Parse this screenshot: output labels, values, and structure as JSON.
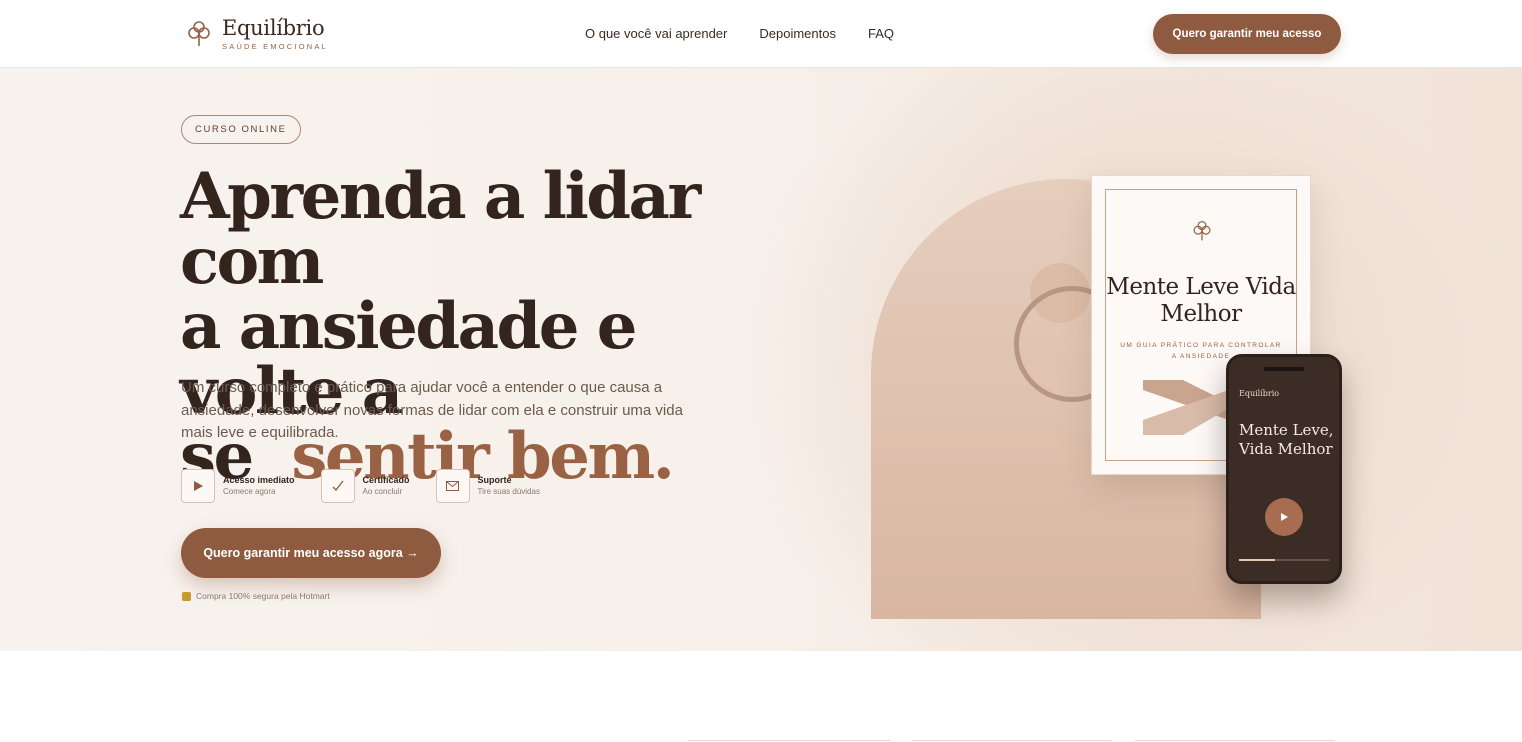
{
  "brand": {
    "name": "Equilíbrio",
    "tagline": "SAÚDE EMOCIONAL"
  },
  "nav": {
    "items": [
      "O que você vai aprender",
      "Depoimentos",
      "FAQ"
    ]
  },
  "header": {
    "cta_label": "Quero garantir meu acesso"
  },
  "hero": {
    "badge": "CURSO ONLINE",
    "headline_line1": "Aprenda a lidar com",
    "headline_line2": "a ansiedade e volte a",
    "headline_line3_prefix": "se",
    "headline_line3_accent": "sentir bem.",
    "lead": "Um curso completo e prático para ajudar você a entender o que causa a ansiedade, desenvolver novas formas de lidar com ela e construir uma vida mais leve e equilibrada.",
    "features": [
      {
        "icon": "play-icon",
        "title": "Acesso imediato",
        "sub": "Comece agora"
      },
      {
        "icon": "check-icon",
        "title": "Certificado",
        "sub": "Ao concluir"
      },
      {
        "icon": "mail-icon",
        "title": "Suporte",
        "sub": "Tire suas dúvidas"
      }
    ],
    "cta_label": "Quero garantir meu acesso agora →",
    "secure_note": "Compra 100% segura pela Hotmart"
  },
  "book": {
    "title": "Mente Leve Vida Melhor",
    "subtitle": "UM GUIA PRÁTICO PARA CONTROLAR A ANSIEDADE"
  },
  "phone": {
    "brand": "Equilíbrio",
    "title": "Mente Leve, Vida Melhor",
    "progress": 0.4
  },
  "colors": {
    "accent": "#8e5a40",
    "accent_text": "#9a6244",
    "dark_text": "#33241d",
    "hero_bg": "#f8f3ef"
  }
}
